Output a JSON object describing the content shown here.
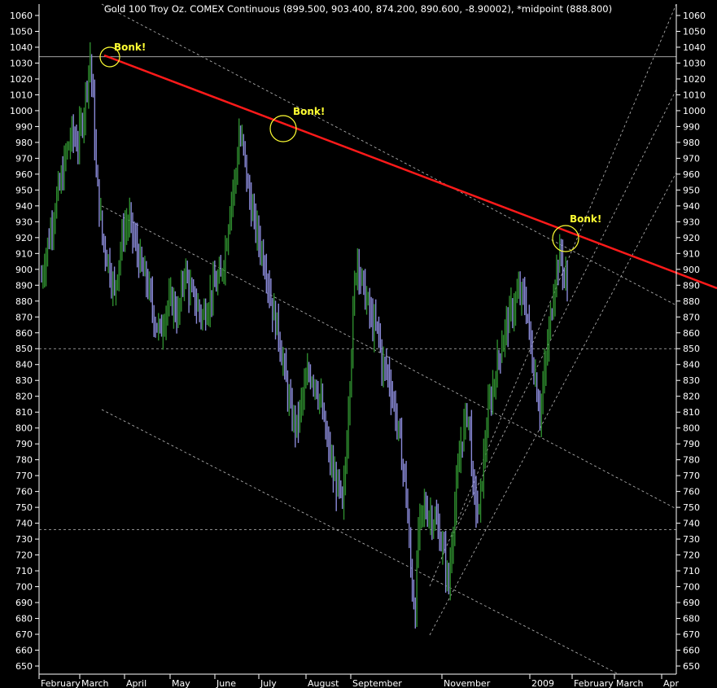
{
  "chart_data": {
    "type": "candlestick",
    "title": "Gold 100 Troy Oz. COMEX Continuous (899.500, 903.400, 874.200, 890.600, -8.90002), *midpoint (888.800)",
    "ylim": [
      650,
      1065
    ],
    "y_ticks": [
      650,
      660,
      670,
      680,
      690,
      700,
      710,
      720,
      730,
      740,
      750,
      760,
      770,
      780,
      790,
      800,
      810,
      820,
      830,
      840,
      850,
      860,
      870,
      880,
      890,
      900,
      910,
      920,
      930,
      940,
      950,
      960,
      970,
      980,
      990,
      1000,
      1010,
      1020,
      1030,
      1040,
      1050,
      1060
    ],
    "x_labels": [
      "February",
      "March",
      "April",
      "May",
      "June",
      "July",
      "August",
      "September",
      "November",
      "2009",
      "February",
      "March",
      "Apr"
    ],
    "colors": {
      "background": "#000000",
      "up_bar": "#2e8b2e",
      "down_bar": "#8a8ad8",
      "trendline": "#ff1a1a",
      "annotation": "#ffff33",
      "guides": "#bbbbbb"
    },
    "horizontal_levels": [
      1034,
      850,
      736
    ],
    "trendline": {
      "from": [
        "Mar 2008",
        1033
      ],
      "to": [
        "Apr 2009",
        888
      ]
    },
    "annotations": [
      {
        "text": "Bonk!",
        "at": [
          "Mar 2008",
          1033
        ]
      },
      {
        "text": "Bonk!",
        "at": [
          "Jul 2008",
          988
        ]
      },
      {
        "text": "Bonk!",
        "at": [
          "Jan 2009",
          918
        ]
      }
    ],
    "price_path": [
      [
        0,
        895
      ],
      [
        2,
        905
      ],
      [
        6,
        925
      ],
      [
        10,
        945
      ],
      [
        14,
        960
      ],
      [
        16,
        972
      ],
      [
        20,
        985
      ],
      [
        24,
        980
      ],
      [
        28,
        1000
      ],
      [
        30,
        1020
      ],
      [
        32,
        1033
      ],
      [
        34,
        1005
      ],
      [
        36,
        960
      ],
      [
        38,
        940
      ],
      [
        40,
        920
      ],
      [
        44,
        905
      ],
      [
        48,
        885
      ],
      [
        50,
        900
      ],
      [
        54,
        925
      ],
      [
        58,
        930
      ],
      [
        62,
        915
      ],
      [
        66,
        900
      ],
      [
        70,
        890
      ],
      [
        74,
        870
      ],
      [
        78,
        860
      ],
      [
        82,
        875
      ],
      [
        86,
        880
      ],
      [
        90,
        870
      ],
      [
        94,
        900
      ],
      [
        98,
        885
      ],
      [
        102,
        878
      ],
      [
        106,
        870
      ],
      [
        110,
        880
      ],
      [
        114,
        890
      ],
      [
        118,
        895
      ],
      [
        122,
        920
      ],
      [
        124,
        940
      ],
      [
        128,
        960
      ],
      [
        130,
        985
      ],
      [
        133,
        975
      ],
      [
        136,
        950
      ],
      [
        140,
        930
      ],
      [
        144,
        915
      ],
      [
        148,
        900
      ],
      [
        152,
        875
      ],
      [
        156,
        860
      ],
      [
        160,
        835
      ],
      [
        164,
        810
      ],
      [
        168,
        800
      ],
      [
        172,
        820
      ],
      [
        176,
        835
      ],
      [
        180,
        830
      ],
      [
        184,
        815
      ],
      [
        188,
        790
      ],
      [
        192,
        770
      ],
      [
        196,
        760
      ],
      [
        198,
        748
      ],
      [
        200,
        775
      ],
      [
        202,
        815
      ],
      [
        204,
        850
      ],
      [
        206,
        890
      ],
      [
        208,
        910
      ],
      [
        210,
        895
      ],
      [
        214,
        880
      ],
      [
        218,
        865
      ],
      [
        222,
        860
      ],
      [
        224,
        840
      ],
      [
        228,
        835
      ],
      [
        232,
        815
      ],
      [
        236,
        790
      ],
      [
        240,
        760
      ],
      [
        242,
        725
      ],
      [
        244,
        700
      ],
      [
        246,
        685
      ],
      [
        248,
        735
      ],
      [
        252,
        750
      ],
      [
        256,
        745
      ],
      [
        260,
        740
      ],
      [
        264,
        725
      ],
      [
        268,
        700
      ],
      [
        270,
        730
      ],
      [
        272,
        750
      ],
      [
        276,
        790
      ],
      [
        280,
        810
      ],
      [
        282,
        800
      ],
      [
        284,
        760
      ],
      [
        288,
        745
      ],
      [
        290,
        770
      ],
      [
        294,
        810
      ],
      [
        298,
        830
      ],
      [
        302,
        850
      ],
      [
        306,
        865
      ],
      [
        310,
        875
      ],
      [
        314,
        885
      ],
      [
        318,
        880
      ],
      [
        320,
        870
      ],
      [
        322,
        850
      ],
      [
        326,
        825
      ],
      [
        328,
        810
      ],
      [
        330,
        825
      ],
      [
        334,
        860
      ],
      [
        338,
        895
      ],
      [
        340,
        905
      ],
      [
        342,
        910
      ],
      [
        344,
        895
      ],
      [
        346,
        890
      ]
    ]
  }
}
